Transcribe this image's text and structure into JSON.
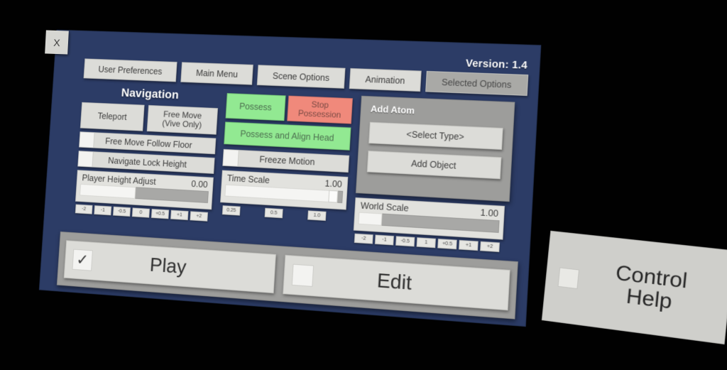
{
  "window": {
    "close_label": "X",
    "version_label": "Version: 1.4"
  },
  "tabs": [
    {
      "label": "User Preferences",
      "active": false
    },
    {
      "label": "Main Menu",
      "active": false
    },
    {
      "label": "Scene Options",
      "active": false
    },
    {
      "label": "Animation",
      "active": false
    },
    {
      "label": "Selected Options",
      "active": true
    }
  ],
  "navigation": {
    "title": "Navigation",
    "teleport_label": "Teleport",
    "free_move_label": "Free Move\n(Vive Only)",
    "free_move_line1": "Free Move",
    "free_move_line2": "(Vive Only)",
    "free_move_follow_floor": {
      "label": "Free Move Follow Floor",
      "checked": false,
      "check_glyph": ""
    },
    "navigate_lock_height": {
      "label": "Navigate Lock Height",
      "checked": false,
      "check_glyph": ""
    },
    "player_height": {
      "label": "Player Height Adjust",
      "value": "0.00",
      "fill_percent": 44,
      "presets": [
        "-2",
        "-1",
        "-0.5",
        "0",
        "+0.5",
        "+1",
        "+2"
      ]
    }
  },
  "possession": {
    "possess_label": "Possess",
    "stop_possession_line1": "Stop",
    "stop_possession_line2": "Possession",
    "possess_align_head_label": "Possess and Align Head",
    "freeze_motion": {
      "label": "Freeze Motion",
      "checked": false,
      "check_glyph": ""
    },
    "time_scale": {
      "label": "Time Scale",
      "value": "1.00",
      "fill_percent": 96,
      "presets": [
        "0.25",
        "0.5",
        "1.0"
      ]
    }
  },
  "add_atom": {
    "title": "Add Atom",
    "select_type_label": "<Select Type>",
    "add_object_label": "Add Object",
    "world_scale": {
      "label": "World Scale",
      "value": "1.00",
      "fill_percent": 17,
      "presets": [
        "-2",
        "-1",
        "-0.5",
        "1",
        "+0.5",
        "+1",
        "+2"
      ]
    }
  },
  "bottom": {
    "play": {
      "label": "Play",
      "checked": true,
      "check_glyph": "✓"
    },
    "edit": {
      "label": "Edit",
      "checked": false,
      "check_glyph": ""
    }
  },
  "control_help": {
    "line1": "Control",
    "line2": "Help",
    "checked": false,
    "check_glyph": ""
  },
  "colors": {
    "panel_bg": "#2c3c66",
    "button_bg": "#dcdcd8",
    "tab_active_bg": "#a9a9a6",
    "green": "#92e992",
    "red": "#f0897b",
    "subpanel_bg": "#9d9d9b"
  }
}
